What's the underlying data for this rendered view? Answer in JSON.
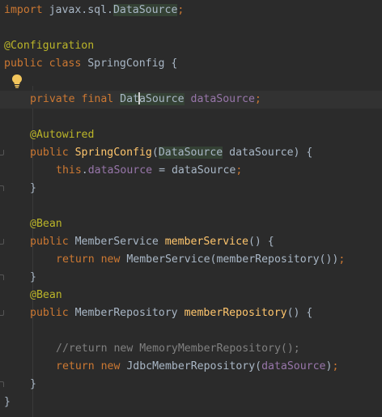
{
  "editor": {
    "line_import": {
      "kw": "import",
      "pkg": " javax.sql.",
      "cls": "DataSource",
      "semi": ";"
    },
    "line_config_ann": "@Configuration",
    "line_class": {
      "kw": "public class",
      "name": " SpringConfig {"
    },
    "line_field": {
      "kw": "private final ",
      "type_a": "Dat",
      "type_b": "aSource",
      "name": "dataSource",
      "semi": ";"
    },
    "line_autowired": "@Autowired",
    "line_ctor": {
      "kw": "public ",
      "name": "SpringConfig",
      "open": "(",
      "type": "DataSource",
      "param": " dataSource) {"
    },
    "line_assign": {
      "kw": "this",
      "dot": ".",
      "field": "dataSource",
      "rest": " = dataSource",
      "semi": ";"
    },
    "line_close_ctor": "}",
    "line_bean1": "@Bean",
    "line_ms_decl": {
      "kw": "public ",
      "type": "MemberService ",
      "name": "memberService",
      "rest": "() {"
    },
    "line_ms_return": {
      "kw": "return new ",
      "call": "MemberService(memberRepository())",
      "semi": ";"
    },
    "line_close_ms": "}",
    "line_bean2": "@Bean",
    "line_mr_decl": {
      "kw": "public ",
      "type": "MemberRepository ",
      "name": "memberRepository",
      "rest": "() {"
    },
    "line_comment": "//return new MemoryMemberRepository();",
    "line_mr_return": {
      "kw": "return new ",
      "call": "JdbcMemberRepository(",
      "arg": "dataSource",
      "close": ")",
      "semi": ";"
    },
    "line_close_mr": "}",
    "line_close_class": "}"
  }
}
